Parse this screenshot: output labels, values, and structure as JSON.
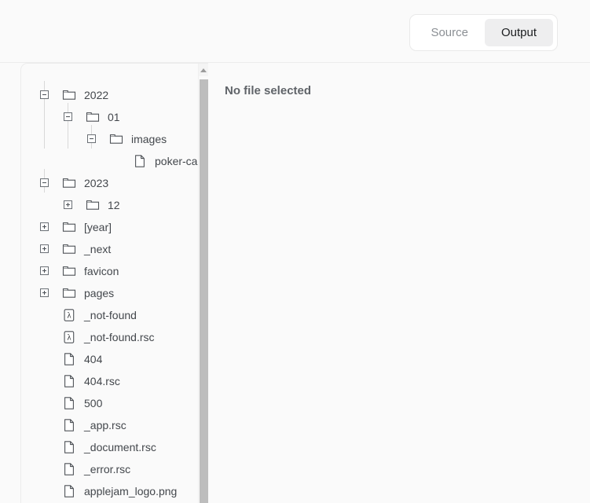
{
  "toolbar": {
    "segmented": {
      "options": [
        {
          "label": "Source",
          "active": false,
          "name": "tab-source"
        },
        {
          "label": "Output",
          "active": true,
          "name": "tab-output"
        }
      ]
    }
  },
  "colors": {
    "page_bg": "#fafafa",
    "panel_border": "#ececec",
    "active_tab_bg": "#eeeeef",
    "text_primary": "#1b1d1f",
    "text_muted": "#8b8f94",
    "tree_text": "#43474c",
    "scrollbar_thumb": "#bdbdbd",
    "tree_line": "#d8d8d8"
  },
  "content": {
    "empty_state": "No file selected"
  },
  "scrollbar": {
    "up_arrow_icon": "triangle-up-icon",
    "visible": true
  },
  "tree": {
    "nodes": [
      {
        "label": "2022",
        "depth": 0,
        "kind": "folder",
        "state": "expanded",
        "icon": "folder-icon",
        "toggle_icon": "minus-box-icon"
      },
      {
        "label": "01",
        "depth": 1,
        "kind": "folder",
        "state": "expanded",
        "icon": "folder-icon",
        "toggle_icon": "minus-box-icon"
      },
      {
        "label": "images",
        "depth": 2,
        "kind": "folder",
        "state": "expanded",
        "icon": "folder-icon",
        "toggle_icon": "minus-box-icon"
      },
      {
        "label": "poker-ca",
        "depth": 3,
        "kind": "file",
        "state": "leaf",
        "icon": "file-icon",
        "toggle_icon": "",
        "truncated": true
      },
      {
        "label": "2023",
        "depth": 0,
        "kind": "folder",
        "state": "expanded",
        "icon": "folder-icon",
        "toggle_icon": "minus-box-icon"
      },
      {
        "label": "12",
        "depth": 1,
        "kind": "folder",
        "state": "collapsed",
        "icon": "folder-icon",
        "toggle_icon": "plus-box-icon"
      },
      {
        "label": "[year]",
        "depth": 0,
        "kind": "folder",
        "state": "collapsed",
        "icon": "folder-icon",
        "toggle_icon": "plus-box-icon"
      },
      {
        "label": "_next",
        "depth": 0,
        "kind": "folder",
        "state": "collapsed",
        "icon": "folder-icon",
        "toggle_icon": "plus-box-icon"
      },
      {
        "label": "favicon",
        "depth": 0,
        "kind": "folder",
        "state": "collapsed",
        "icon": "folder-icon",
        "toggle_icon": "plus-box-icon"
      },
      {
        "label": "pages",
        "depth": 0,
        "kind": "folder",
        "state": "collapsed",
        "icon": "folder-icon",
        "toggle_icon": "plus-box-icon"
      },
      {
        "label": "_not-found",
        "depth": 0,
        "kind": "lambda",
        "state": "leaf",
        "icon": "lambda-icon",
        "toggle_icon": ""
      },
      {
        "label": "_not-found.rsc",
        "depth": 0,
        "kind": "lambda",
        "state": "leaf",
        "icon": "lambda-icon",
        "toggle_icon": ""
      },
      {
        "label": "404",
        "depth": 0,
        "kind": "file",
        "state": "leaf",
        "icon": "file-icon",
        "toggle_icon": ""
      },
      {
        "label": "404.rsc",
        "depth": 0,
        "kind": "file",
        "state": "leaf",
        "icon": "file-icon",
        "toggle_icon": ""
      },
      {
        "label": "500",
        "depth": 0,
        "kind": "file",
        "state": "leaf",
        "icon": "file-icon",
        "toggle_icon": ""
      },
      {
        "label": "_app.rsc",
        "depth": 0,
        "kind": "file",
        "state": "leaf",
        "icon": "file-icon",
        "toggle_icon": ""
      },
      {
        "label": "_document.rsc",
        "depth": 0,
        "kind": "file",
        "state": "leaf",
        "icon": "file-icon",
        "toggle_icon": ""
      },
      {
        "label": "_error.rsc",
        "depth": 0,
        "kind": "file",
        "state": "leaf",
        "icon": "file-icon",
        "toggle_icon": ""
      },
      {
        "label": "applejam_logo.png",
        "depth": 0,
        "kind": "file",
        "state": "leaf",
        "icon": "file-icon",
        "toggle_icon": ""
      }
    ]
  }
}
